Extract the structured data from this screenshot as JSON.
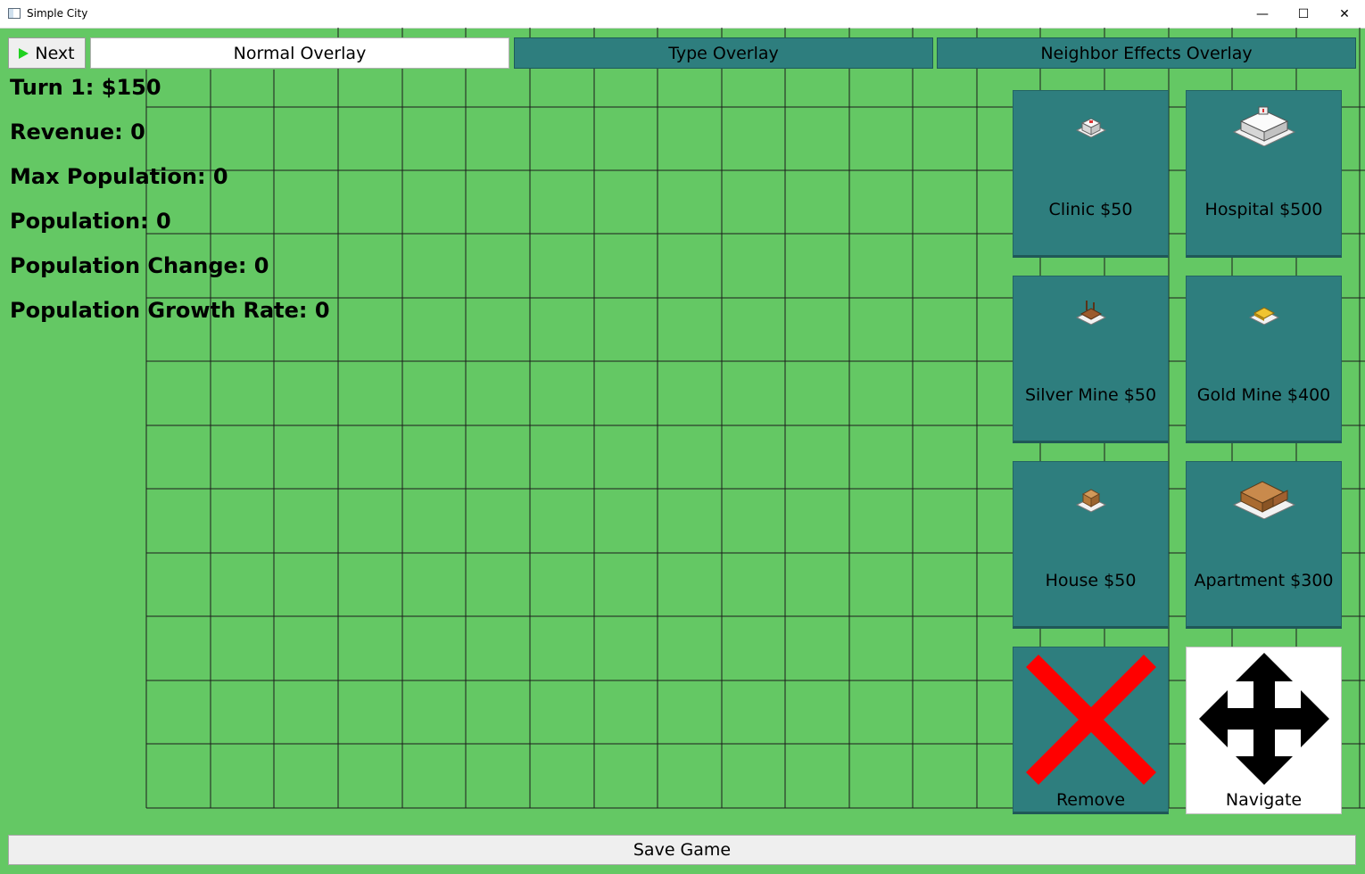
{
  "window": {
    "title": "Simple City",
    "controls": {
      "minimize": "—",
      "maximize": "☐",
      "close": "✕"
    }
  },
  "toolbar": {
    "next_label": "Next",
    "overlays": [
      {
        "label": "Normal Overlay",
        "active": true
      },
      {
        "label": "Type Overlay",
        "active": false
      },
      {
        "label": "Neighbor Effects Overlay",
        "active": false
      }
    ]
  },
  "stats": {
    "turn": "Turn 1: $150",
    "revenue": "Revenue: 0",
    "max_population": "Max Population: 0",
    "population": "Population: 0",
    "population_change": "Population Change: 0",
    "population_growth_rate": "Population Growth Rate: 0"
  },
  "buildings": [
    {
      "label": "Clinic $50",
      "icon": "clinic-icon"
    },
    {
      "label": "Hospital $500",
      "icon": "hospital-icon"
    },
    {
      "label": "Silver Mine $50",
      "icon": "silver-mine-icon"
    },
    {
      "label": "Gold Mine $400",
      "icon": "gold-mine-icon"
    },
    {
      "label": "House $50",
      "icon": "house-icon"
    },
    {
      "label": "Apartment $300",
      "icon": "apartment-icon"
    }
  ],
  "tools": {
    "remove_label": "Remove",
    "navigate_label": "Navigate"
  },
  "footer": {
    "save_label": "Save Game"
  },
  "colors": {
    "background": "#64c864",
    "tile": "#2e7e7e",
    "remove_x": "#ff0000",
    "play": "#1fd11f"
  }
}
